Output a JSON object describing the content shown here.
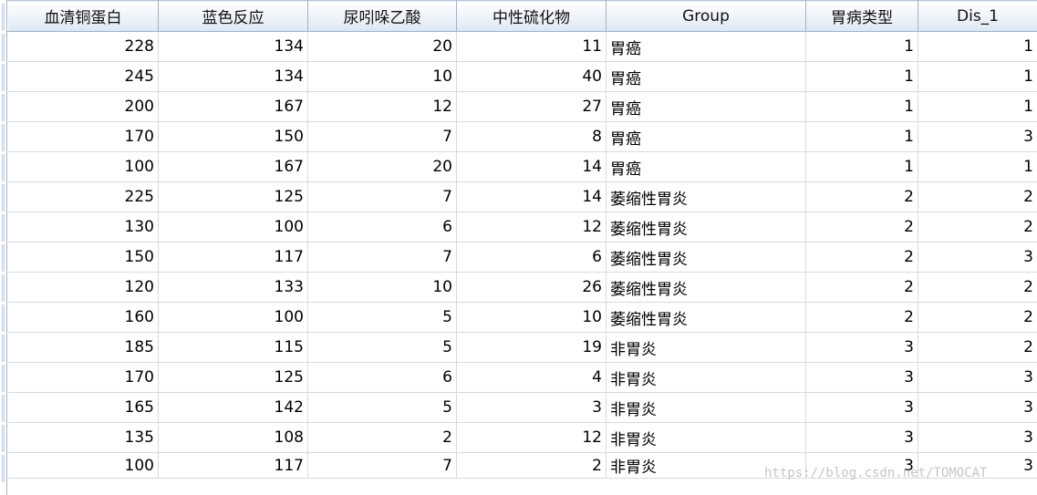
{
  "columns": [
    "血清铜蛋白",
    "蓝色反应",
    "尿吲哚乙酸",
    "中性硫化物",
    "Group",
    "胃病类型",
    "Dis_1"
  ],
  "rows": [
    [
      "228",
      "134",
      "20",
      "11",
      "胃癌",
      "1",
      "1"
    ],
    [
      "245",
      "134",
      "10",
      "40",
      "胃癌",
      "1",
      "1"
    ],
    [
      "200",
      "167",
      "12",
      "27",
      "胃癌",
      "1",
      "1"
    ],
    [
      "170",
      "150",
      "7",
      "8",
      "胃癌",
      "1",
      "3"
    ],
    [
      "100",
      "167",
      "20",
      "14",
      "胃癌",
      "1",
      "1"
    ],
    [
      "225",
      "125",
      "7",
      "14",
      "萎缩性胃炎",
      "2",
      "2"
    ],
    [
      "130",
      "100",
      "6",
      "12",
      "萎缩性胃炎",
      "2",
      "2"
    ],
    [
      "150",
      "117",
      "7",
      "6",
      "萎缩性胃炎",
      "2",
      "3"
    ],
    [
      "120",
      "133",
      "10",
      "26",
      "萎缩性胃炎",
      "2",
      "2"
    ],
    [
      "160",
      "100",
      "5",
      "10",
      "萎缩性胃炎",
      "2",
      "2"
    ],
    [
      "185",
      "115",
      "5",
      "19",
      "非胃炎",
      "3",
      "2"
    ],
    [
      "170",
      "125",
      "6",
      "4",
      "非胃炎",
      "3",
      "3"
    ],
    [
      "165",
      "142",
      "5",
      "3",
      "非胃炎",
      "3",
      "3"
    ],
    [
      "135",
      "108",
      "2",
      "12",
      "非胃炎",
      "3",
      "3"
    ],
    [
      "100",
      "117",
      "7",
      "2",
      "非胃炎",
      "3",
      "3"
    ]
  ],
  "watermark": "https://blog.csdn.net/TOMOCAT"
}
